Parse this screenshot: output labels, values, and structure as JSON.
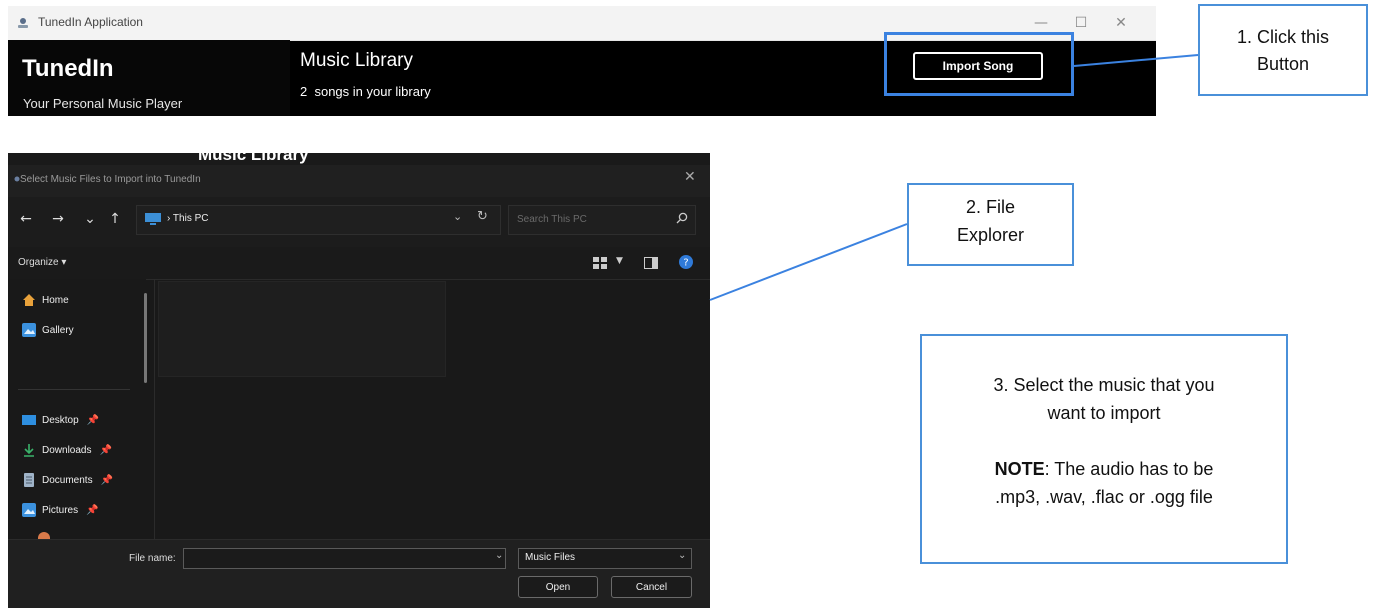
{
  "app": {
    "window_title": "TunedIn Application",
    "brand": "TunedIn",
    "tagline": "Your Personal Music Player",
    "library_title": "Music Library",
    "library_count": "2",
    "library_count_suffix": "songs in your library",
    "import_button": "Import Song",
    "window_controls": {
      "minimize": "—",
      "maximize": "☐",
      "close": "✕"
    }
  },
  "callouts": {
    "step1": "1.  Click this\nButton",
    "step2": "2. File\nExplorer",
    "step3_line1": "3. Select the  music that you\nwant to import",
    "step3_note_label": "NOTE",
    "step3_note_text": ": The audio has to be\n.mp3, .wav, .flac  or .ogg file"
  },
  "dialog": {
    "background_heading": "Music Library",
    "title": "Select Music Files to Import into TunedIn",
    "nav": {
      "back": "←",
      "forward": "→",
      "recent": "⌄",
      "up": "↑"
    },
    "address_path": "› This PC",
    "search_placeholder": "Search This PC",
    "organize": "Organize ▾",
    "sidebar": [
      {
        "label": "Home",
        "icon": "home-icon",
        "pinned": false
      },
      {
        "label": "Gallery",
        "icon": "gallery-icon",
        "pinned": false
      },
      {
        "label": "Desktop",
        "icon": "desktop-icon",
        "pinned": true
      },
      {
        "label": "Downloads",
        "icon": "downloads-icon",
        "pinned": true
      },
      {
        "label": "Documents",
        "icon": "documents-icon",
        "pinned": true
      },
      {
        "label": "Pictures",
        "icon": "pictures-icon",
        "pinned": true
      }
    ],
    "file_name_label": "File name:",
    "file_name_value": "",
    "file_type": "Music Files",
    "open_button": "Open",
    "cancel_button": "Cancel"
  },
  "colors": {
    "highlight": "#3b82e0",
    "callout_border": "#4a90d9",
    "app_bg": "#000000",
    "dialog_bg": "#191919"
  }
}
